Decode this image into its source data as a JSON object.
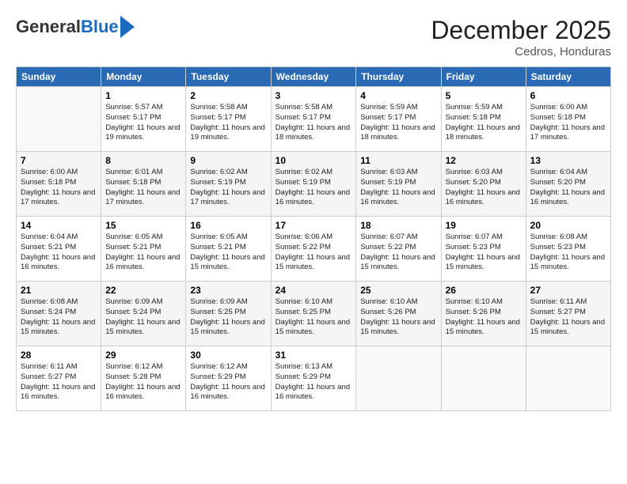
{
  "header": {
    "logo_general": "General",
    "logo_blue": "Blue",
    "month_year": "December 2025",
    "location": "Cedros, Honduras"
  },
  "days_of_week": [
    "Sunday",
    "Monday",
    "Tuesday",
    "Wednesday",
    "Thursday",
    "Friday",
    "Saturday"
  ],
  "weeks": [
    [
      {
        "day": "",
        "info": ""
      },
      {
        "day": "1",
        "info": "Sunrise: 5:57 AM\nSunset: 5:17 PM\nDaylight: 11 hours and 19 minutes."
      },
      {
        "day": "2",
        "info": "Sunrise: 5:58 AM\nSunset: 5:17 PM\nDaylight: 11 hours and 19 minutes."
      },
      {
        "day": "3",
        "info": "Sunrise: 5:58 AM\nSunset: 5:17 PM\nDaylight: 11 hours and 18 minutes."
      },
      {
        "day": "4",
        "info": "Sunrise: 5:59 AM\nSunset: 5:17 PM\nDaylight: 11 hours and 18 minutes."
      },
      {
        "day": "5",
        "info": "Sunrise: 5:59 AM\nSunset: 5:18 PM\nDaylight: 11 hours and 18 minutes."
      },
      {
        "day": "6",
        "info": "Sunrise: 6:00 AM\nSunset: 5:18 PM\nDaylight: 11 hours and 17 minutes."
      }
    ],
    [
      {
        "day": "7",
        "info": "Sunrise: 6:00 AM\nSunset: 5:18 PM\nDaylight: 11 hours and 17 minutes."
      },
      {
        "day": "8",
        "info": "Sunrise: 6:01 AM\nSunset: 5:18 PM\nDaylight: 11 hours and 17 minutes."
      },
      {
        "day": "9",
        "info": "Sunrise: 6:02 AM\nSunset: 5:19 PM\nDaylight: 11 hours and 17 minutes."
      },
      {
        "day": "10",
        "info": "Sunrise: 6:02 AM\nSunset: 5:19 PM\nDaylight: 11 hours and 16 minutes."
      },
      {
        "day": "11",
        "info": "Sunrise: 6:03 AM\nSunset: 5:19 PM\nDaylight: 11 hours and 16 minutes."
      },
      {
        "day": "12",
        "info": "Sunrise: 6:03 AM\nSunset: 5:20 PM\nDaylight: 11 hours and 16 minutes."
      },
      {
        "day": "13",
        "info": "Sunrise: 6:04 AM\nSunset: 5:20 PM\nDaylight: 11 hours and 16 minutes."
      }
    ],
    [
      {
        "day": "14",
        "info": "Sunrise: 6:04 AM\nSunset: 5:21 PM\nDaylight: 11 hours and 16 minutes."
      },
      {
        "day": "15",
        "info": "Sunrise: 6:05 AM\nSunset: 5:21 PM\nDaylight: 11 hours and 16 minutes."
      },
      {
        "day": "16",
        "info": "Sunrise: 6:05 AM\nSunset: 5:21 PM\nDaylight: 11 hours and 15 minutes."
      },
      {
        "day": "17",
        "info": "Sunrise: 6:06 AM\nSunset: 5:22 PM\nDaylight: 11 hours and 15 minutes."
      },
      {
        "day": "18",
        "info": "Sunrise: 6:07 AM\nSunset: 5:22 PM\nDaylight: 11 hours and 15 minutes."
      },
      {
        "day": "19",
        "info": "Sunrise: 6:07 AM\nSunset: 5:23 PM\nDaylight: 11 hours and 15 minutes."
      },
      {
        "day": "20",
        "info": "Sunrise: 6:08 AM\nSunset: 5:23 PM\nDaylight: 11 hours and 15 minutes."
      }
    ],
    [
      {
        "day": "21",
        "info": "Sunrise: 6:08 AM\nSunset: 5:24 PM\nDaylight: 11 hours and 15 minutes."
      },
      {
        "day": "22",
        "info": "Sunrise: 6:09 AM\nSunset: 5:24 PM\nDaylight: 11 hours and 15 minutes."
      },
      {
        "day": "23",
        "info": "Sunrise: 6:09 AM\nSunset: 5:25 PM\nDaylight: 11 hours and 15 minutes."
      },
      {
        "day": "24",
        "info": "Sunrise: 6:10 AM\nSunset: 5:25 PM\nDaylight: 11 hours and 15 minutes."
      },
      {
        "day": "25",
        "info": "Sunrise: 6:10 AM\nSunset: 5:26 PM\nDaylight: 11 hours and 15 minutes."
      },
      {
        "day": "26",
        "info": "Sunrise: 6:10 AM\nSunset: 5:26 PM\nDaylight: 11 hours and 15 minutes."
      },
      {
        "day": "27",
        "info": "Sunrise: 6:11 AM\nSunset: 5:27 PM\nDaylight: 11 hours and 15 minutes."
      }
    ],
    [
      {
        "day": "28",
        "info": "Sunrise: 6:11 AM\nSunset: 5:27 PM\nDaylight: 11 hours and 16 minutes."
      },
      {
        "day": "29",
        "info": "Sunrise: 6:12 AM\nSunset: 5:28 PM\nDaylight: 11 hours and 16 minutes."
      },
      {
        "day": "30",
        "info": "Sunrise: 6:12 AM\nSunset: 5:29 PM\nDaylight: 11 hours and 16 minutes."
      },
      {
        "day": "31",
        "info": "Sunrise: 6:13 AM\nSunset: 5:29 PM\nDaylight: 11 hours and 16 minutes."
      },
      {
        "day": "",
        "info": ""
      },
      {
        "day": "",
        "info": ""
      },
      {
        "day": "",
        "info": ""
      }
    ]
  ]
}
